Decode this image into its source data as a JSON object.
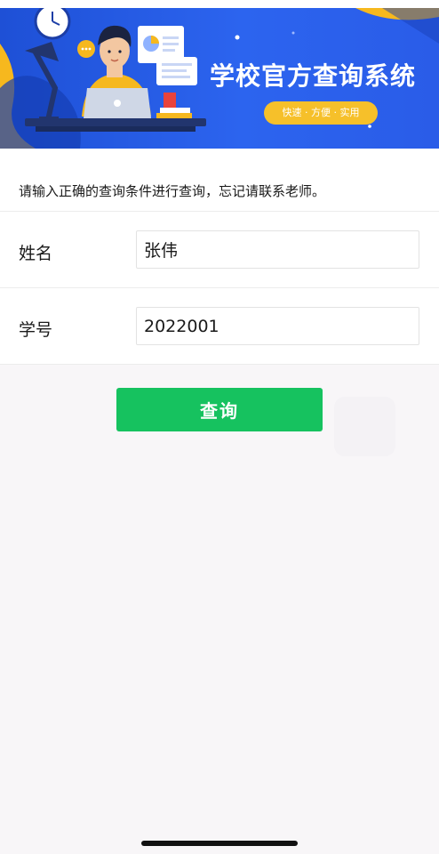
{
  "banner": {
    "title": "学校官方查询系统",
    "subtitle": "快速 · 方便 · 实用"
  },
  "form": {
    "notice": "请输入正确的查询条件进行查询，忘记请联系老师。",
    "fields": [
      {
        "label": "姓名",
        "value": "张伟"
      },
      {
        "label": "学号",
        "value": "2022001"
      }
    ],
    "submit_label": "查询"
  },
  "colors": {
    "banner_blue": "#2a5ce8",
    "accent_yellow": "#f6c02a",
    "button_green": "#16c25f"
  }
}
